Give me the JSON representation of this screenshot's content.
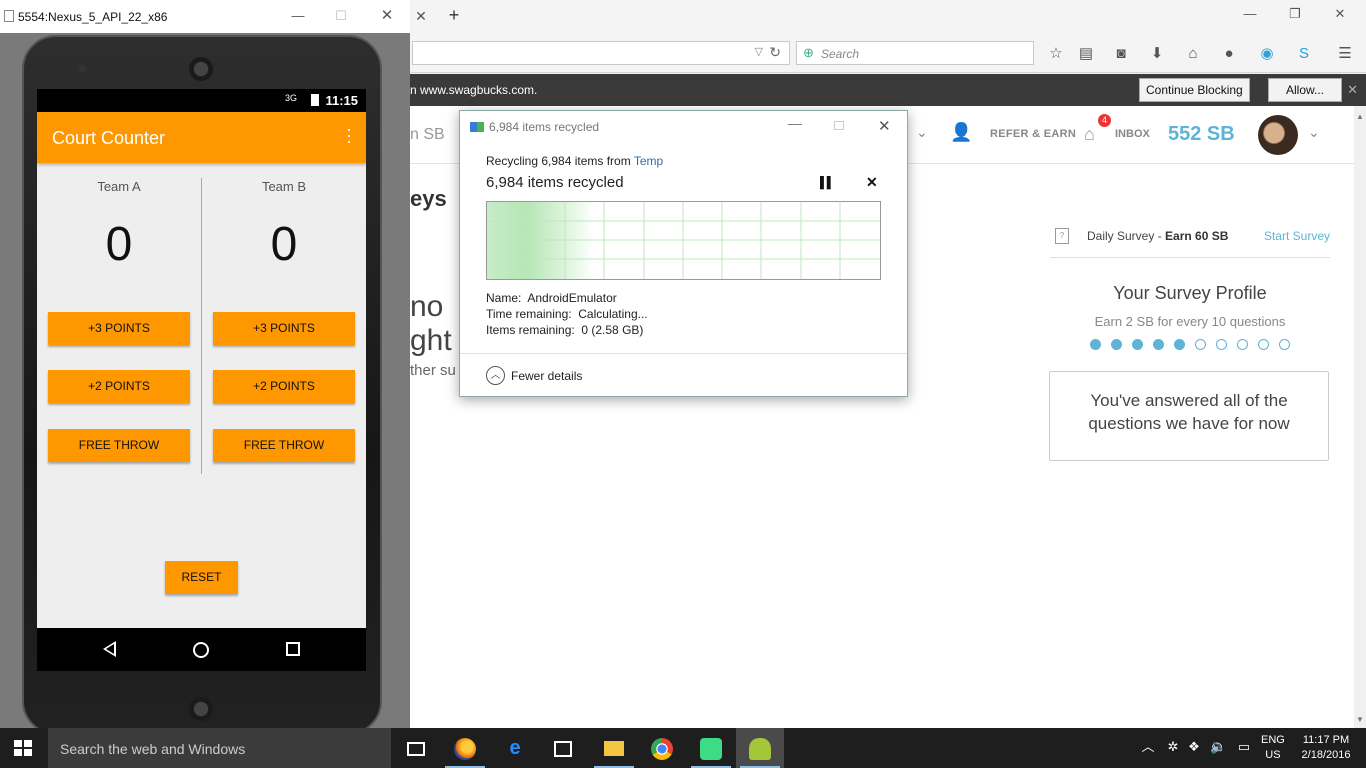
{
  "firefox": {
    "search_placeholder": "Search",
    "notification": {
      "text": "n www.swagbucks.com.",
      "continue_blocking": "Continue Blocking",
      "allow": "Allow..."
    }
  },
  "swagbucks": {
    "search_fragment": "n SB",
    "refer_earn": "REFER & EARN",
    "inbox_label": "INBOX",
    "inbox_badge": "4",
    "balance": "552 SB",
    "heading_fragment": "eys",
    "big_line_1": "no",
    "big_line_2": "ght n",
    "small_line_3": "ther su",
    "daily_survey_prefix": "Daily Survey - ",
    "daily_survey_earn": "Earn 60 SB",
    "start_survey": "Start Survey",
    "profile_title": "Your Survey Profile",
    "profile_sub": "Earn 2 SB for every 10 questions",
    "profile_progress": {
      "filled": 5,
      "total": 10
    },
    "answered_line_1": "You've answered all of the",
    "answered_line_2": "questions we have for now",
    "accent_color": "#5fb3d6"
  },
  "emulator": {
    "window_title": "5554:Nexus_5_API_22_x86",
    "network": "3G",
    "time": "11:15",
    "app_title": "Court Counter",
    "accent_color": "#ff9800",
    "team_a": {
      "name": "Team A",
      "score": "0"
    },
    "team_b": {
      "name": "Team B",
      "score": "0"
    },
    "btn_3": "+3 POINTS",
    "btn_2": "+2 POINTS",
    "btn_ft": "FREE THROW",
    "reset": "RESET"
  },
  "dialog": {
    "title": "6,984 items recycled",
    "from_prefix": "Recycling 6,984 items from ",
    "from_link": "Temp",
    "status": "6,984 items recycled",
    "name_label": "Name:",
    "name_value": "AndroidEmulator",
    "time_label": "Time remaining:",
    "time_value": "Calculating...",
    "items_label": "Items remaining:",
    "items_value": "0 (2.58 GB)",
    "fewer_details": "Fewer details"
  },
  "taskbar": {
    "search_text": "Search the web and Windows",
    "lang_1": "ENG",
    "lang_2": "US",
    "time": "11:17 PM",
    "date": "2/18/2016"
  }
}
